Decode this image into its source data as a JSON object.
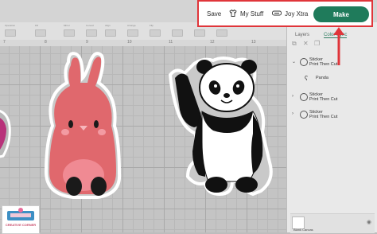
{
  "header": {
    "save_label": "Save",
    "my_stuff_label": "My Stuff",
    "joy_xtra_label": "Joy Xtra",
    "make_label": "Make"
  },
  "toolstrip": {
    "labels": [
      "Operation",
      "",
      "Fill",
      "",
      "Mirror",
      "",
      "Curved",
      "Align",
      "",
      "Arrange",
      "",
      "Flip",
      ""
    ]
  },
  "ruler": {
    "numbers": [
      "7",
      "8",
      "9",
      "10",
      "11",
      "12",
      "13"
    ]
  },
  "panel": {
    "tabs": [
      "Layers",
      "Color Sync"
    ],
    "layers": [
      {
        "title": "Sticker",
        "subtitle": "Print Then Cut"
      },
      {
        "title": "Sticker",
        "subtitle": "Print Then Cut"
      },
      {
        "title": "Sticker",
        "subtitle": "Print Then Cut"
      }
    ],
    "sublayer_label": "Panda",
    "blank_canvas_label": "Blank Canvas"
  },
  "logo": {
    "text": "CREATIVE CORNER"
  },
  "colors": {
    "make": "#1f7b5b",
    "highlight": "#e0353a",
    "arrow": "#e0353a"
  },
  "icons": [
    "tshirt-icon",
    "joy-machine-icon",
    "layers-icon",
    "eye-icon"
  ]
}
